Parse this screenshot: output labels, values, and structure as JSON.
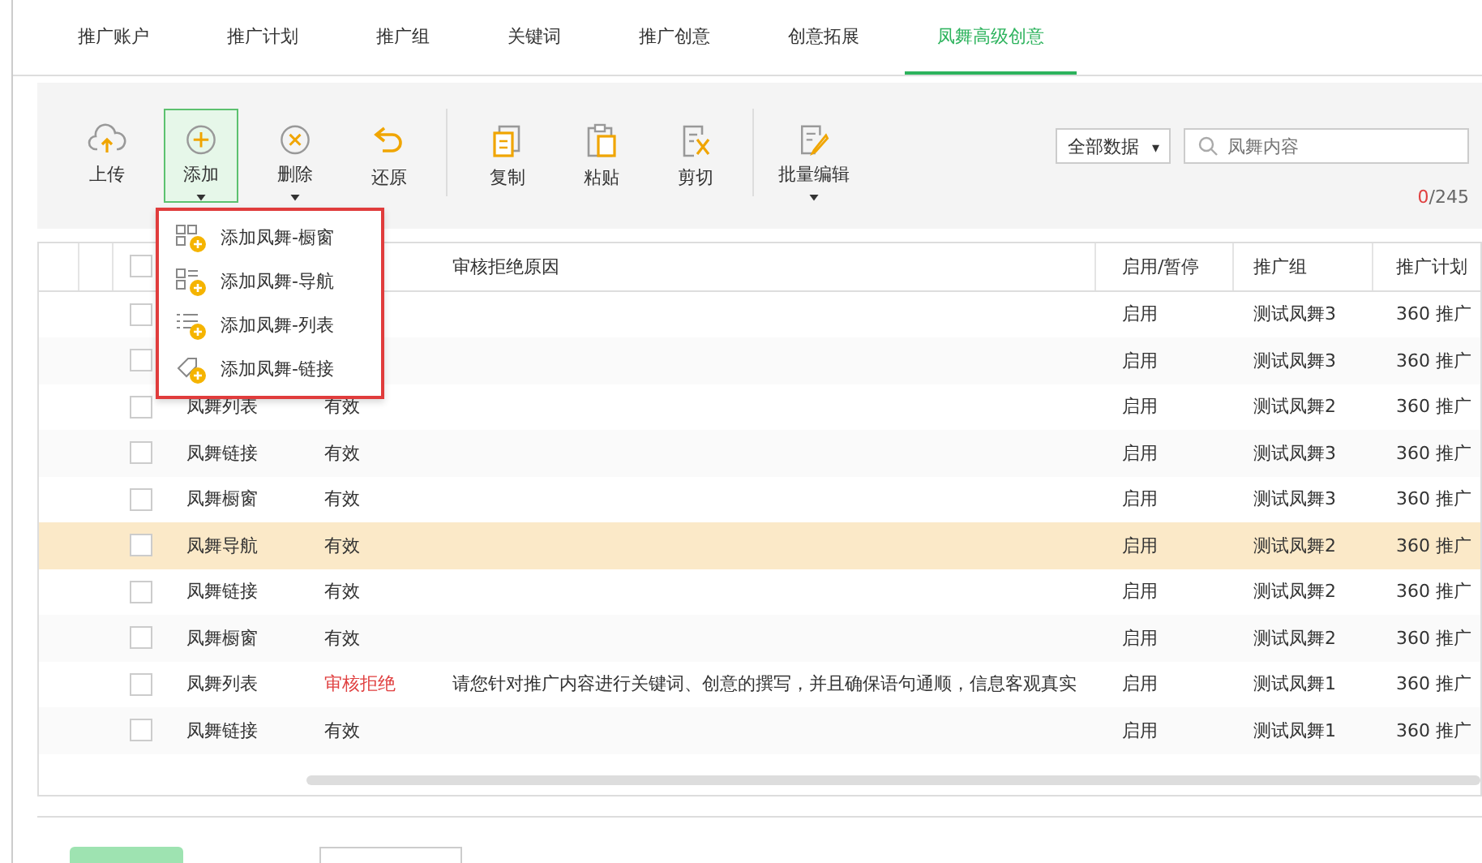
{
  "tabs": [
    {
      "label": "推广账户",
      "selected": false
    },
    {
      "label": "推广计划",
      "selected": false
    },
    {
      "label": "推广组",
      "selected": false
    },
    {
      "label": "关键词",
      "selected": false
    },
    {
      "label": "推广创意",
      "selected": false
    },
    {
      "label": "创意拓展",
      "selected": false
    },
    {
      "label": "凤舞高级创意",
      "selected": true
    }
  ],
  "toolbar": {
    "buttons": [
      {
        "label": "上传",
        "kind": "upload",
        "selected": false,
        "caret": false
      },
      {
        "label": "添加",
        "kind": "add",
        "selected": true,
        "caret": true
      },
      {
        "label": "删除",
        "kind": "delete",
        "selected": false,
        "caret": true
      },
      {
        "label": "还原",
        "kind": "undo",
        "selected": false,
        "caret": false
      },
      {
        "label": "复制",
        "kind": "copy",
        "selected": false,
        "caret": false
      },
      {
        "label": "粘贴",
        "kind": "paste",
        "selected": false,
        "caret": false
      },
      {
        "label": "剪切",
        "kind": "cut",
        "selected": false,
        "caret": false
      },
      {
        "label": "批量编辑",
        "kind": "edit",
        "selected": false,
        "caret": true
      }
    ],
    "filter": {
      "value": "全部数据",
      "caret": "▾"
    },
    "search": {
      "placeholder": "凤舞内容"
    },
    "count": {
      "selected": "0",
      "total": "/245"
    }
  },
  "add_menu": [
    {
      "label": "添加凤舞-橱窗",
      "kind": "grid"
    },
    {
      "label": "添加凤舞-导航",
      "kind": "nav"
    },
    {
      "label": "添加凤舞-列表",
      "kind": "list"
    },
    {
      "label": "添加凤舞-链接",
      "kind": "link"
    }
  ],
  "table": {
    "all_checked": false,
    "columns": [
      "审核拒绝原因",
      "启用/暂停",
      "推广组",
      "推广计划"
    ],
    "rows": [
      {
        "selected": false,
        "checked": false,
        "enabled": "启用",
        "group": "测试凤舞3",
        "plan": "360 推广"
      },
      {
        "selected": false,
        "checked": false,
        "enabled": "启用",
        "group": "测试凤舞3",
        "plan": "360 推广"
      },
      {
        "selected": false,
        "checked": false,
        "name": "凤舞列表",
        "status": "有效",
        "rejected": false,
        "enabled": "启用",
        "group": "测试凤舞2",
        "plan": "360 推广"
      },
      {
        "selected": false,
        "checked": false,
        "name": "凤舞链接",
        "status": "有效",
        "rejected": false,
        "enabled": "启用",
        "group": "测试凤舞3",
        "plan": "360 推广"
      },
      {
        "selected": false,
        "checked": false,
        "name": "凤舞橱窗",
        "status": "有效",
        "rejected": false,
        "enabled": "启用",
        "group": "测试凤舞3",
        "plan": "360 推广"
      },
      {
        "selected": true,
        "checked": false,
        "name": "凤舞导航",
        "status": "有效",
        "rejected": false,
        "enabled": "启用",
        "group": "测试凤舞2",
        "plan": "360 推广"
      },
      {
        "selected": false,
        "checked": false,
        "name": "凤舞链接",
        "status": "有效",
        "rejected": false,
        "enabled": "启用",
        "group": "测试凤舞2",
        "plan": "360 推广"
      },
      {
        "selected": false,
        "checked": false,
        "name": "凤舞橱窗",
        "status": "有效",
        "rejected": false,
        "enabled": "启用",
        "group": "测试凤舞2",
        "plan": "360 推广"
      },
      {
        "selected": false,
        "checked": false,
        "name": "凤舞列表",
        "status": "审核拒绝",
        "rejected": true,
        "reason": "请您针对推广内容进行关键词、创意的撰写，并且确保语句通顺，信息客观真实",
        "enabled": "启用",
        "group": "测试凤舞1",
        "plan": "360 推广"
      },
      {
        "selected": false,
        "checked": false,
        "name": "凤舞链接",
        "status": "有效",
        "rejected": false,
        "enabled": "启用",
        "group": "测试凤舞1",
        "plan": "360 推广"
      }
    ]
  }
}
